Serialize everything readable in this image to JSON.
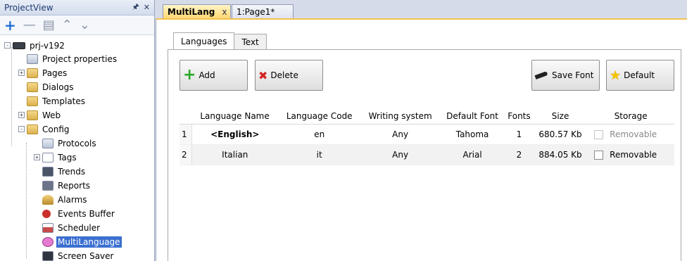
{
  "project_view": {
    "title": "ProjectView",
    "pin_glyph": "p",
    "close_glyph": "✕",
    "tree": [
      {
        "label": "prj-v192",
        "level": 0,
        "expander": "-",
        "icon": "project"
      },
      {
        "label": "Project properties",
        "level": 1,
        "expander": "",
        "icon": "properties"
      },
      {
        "label": "Pages",
        "level": 1,
        "expander": "+",
        "icon": "folder"
      },
      {
        "label": "Dialogs",
        "level": 1,
        "expander": "",
        "icon": "folder"
      },
      {
        "label": "Templates",
        "level": 1,
        "expander": "",
        "icon": "folder"
      },
      {
        "label": "Web",
        "level": 1,
        "expander": "+",
        "icon": "folder"
      },
      {
        "label": "Config",
        "level": 1,
        "expander": "-",
        "icon": "folder"
      },
      {
        "label": "Protocols",
        "level": 2,
        "expander": "",
        "icon": "protocols"
      },
      {
        "label": "Tags",
        "level": 2,
        "expander": "+",
        "icon": "tags"
      },
      {
        "label": "Trends",
        "level": 2,
        "expander": "",
        "icon": "trends"
      },
      {
        "label": "Reports",
        "level": 2,
        "expander": "",
        "icon": "reports"
      },
      {
        "label": "Alarms",
        "level": 2,
        "expander": "",
        "icon": "alarms"
      },
      {
        "label": "Events Buffer",
        "level": 2,
        "expander": "",
        "icon": "events"
      },
      {
        "label": "Scheduler",
        "level": 2,
        "expander": "",
        "icon": "scheduler"
      },
      {
        "label": "MultiLanguage",
        "level": 2,
        "expander": "",
        "icon": "multilanguage",
        "selected": true
      },
      {
        "label": "Screen Saver",
        "level": 2,
        "expander": "",
        "icon": "screensaver"
      }
    ]
  },
  "doc_tabs": [
    {
      "label": "MultiLang",
      "close": "x",
      "active": true
    },
    {
      "label": "1:Page1*",
      "active": false
    }
  ],
  "inner_tabs": [
    {
      "label": "Languages",
      "active": true
    },
    {
      "label": "Text",
      "active": false
    }
  ],
  "toolbar": {
    "add_label": "Add",
    "delete_label": "Delete",
    "save_font_label": "Save Font",
    "default_label": "Default"
  },
  "table": {
    "headers": [
      "Language Name",
      "Language Code",
      "Writing system",
      "Default Font",
      "Fonts",
      "Size",
      "Storage"
    ],
    "rows": [
      {
        "num": "1",
        "name": "<English>",
        "code": "en",
        "writing": "Any",
        "font": "Tahoma",
        "fonts": "1",
        "size": "680.57 Kb",
        "storage": "Removable",
        "storage_enabled": false
      },
      {
        "num": "2",
        "name": "Italian",
        "code": "it",
        "writing": "Any",
        "font": "Arial",
        "fonts": "2",
        "size": "884.05 Kb",
        "storage": "Removable",
        "storage_enabled": true
      }
    ]
  },
  "colors": {
    "selection": "#3b6fd0",
    "active_tab": "#ffd874",
    "add_icon": "#2aa82a",
    "delete_icon": "#d42323"
  }
}
